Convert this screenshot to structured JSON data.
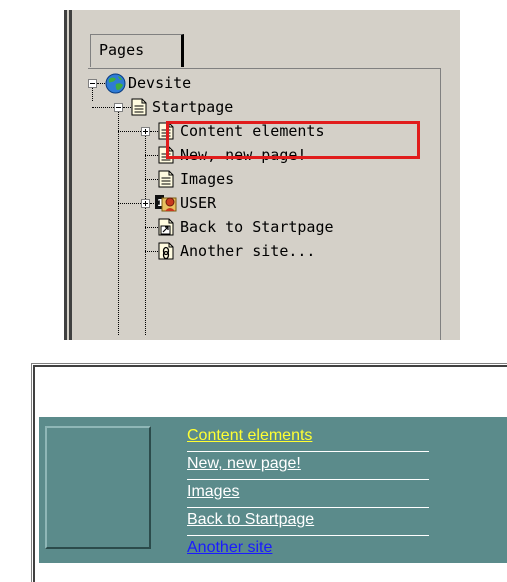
{
  "tree_panel": {
    "tab_label": "Pages",
    "items": [
      {
        "label": "Devsite",
        "icon": "globe-icon",
        "expander": "minus"
      },
      {
        "label": "Startpage",
        "icon": "page-icon",
        "expander": "minus"
      },
      {
        "label": "Content elements",
        "icon": "page-icon",
        "expander": "plus"
      },
      {
        "label": "New, new page!",
        "icon": "page-icon",
        "expander": "none",
        "highlighted": true
      },
      {
        "label": "Images",
        "icon": "page-icon",
        "expander": "none"
      },
      {
        "label": "USER",
        "icon": "user-sysfolder-icon",
        "expander": "plus"
      },
      {
        "label": "Back to Startpage",
        "icon": "shortcut-page-icon",
        "expander": "none"
      },
      {
        "label": "Another site...",
        "icon": "external-link-page-icon",
        "expander": "none"
      }
    ],
    "highlight_color": "#e11c1c"
  },
  "preview": {
    "background_color": "#5b8b8b",
    "menu": [
      {
        "label": "Content elements",
        "color": "#ffff33"
      },
      {
        "label": "New, new page!",
        "color": "#ffffff"
      },
      {
        "label": "Images",
        "color": "#ffffff"
      },
      {
        "label": "Back to Startpage",
        "color": "#ffffff"
      },
      {
        "label": "Another site",
        "color": "#1a1aff"
      }
    ]
  }
}
